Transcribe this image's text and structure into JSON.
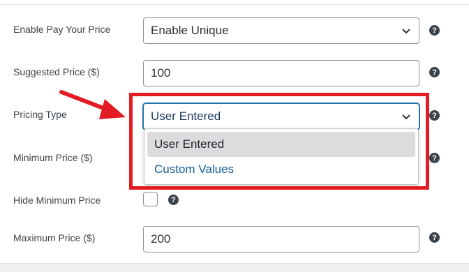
{
  "form": {
    "enable_pay_your_price": {
      "label": "Enable Pay Your Price",
      "value": "Enable Unique"
    },
    "suggested_price": {
      "label": "Suggested Price ($)",
      "value": "100"
    },
    "pricing_type": {
      "label": "Pricing Type",
      "value": "User Entered",
      "options": [
        "User Entered",
        "Custom Values"
      ]
    },
    "minimum_price": {
      "label": "Minimum Price ($)"
    },
    "hide_minimum_price": {
      "label": "Hide Minimum Price",
      "checked": false
    },
    "maximum_price": {
      "label": "Maximum Price ($)",
      "value": "200"
    }
  },
  "help_glyph": "?",
  "icons": {
    "help": "question-circle-icon",
    "chevron": "chevron-down-icon",
    "annotation": "red-arrow-icon"
  },
  "colors": {
    "annotation": "#e31b23",
    "focus": "#2271b1",
    "selected_option_bg": "#dcdcde"
  }
}
